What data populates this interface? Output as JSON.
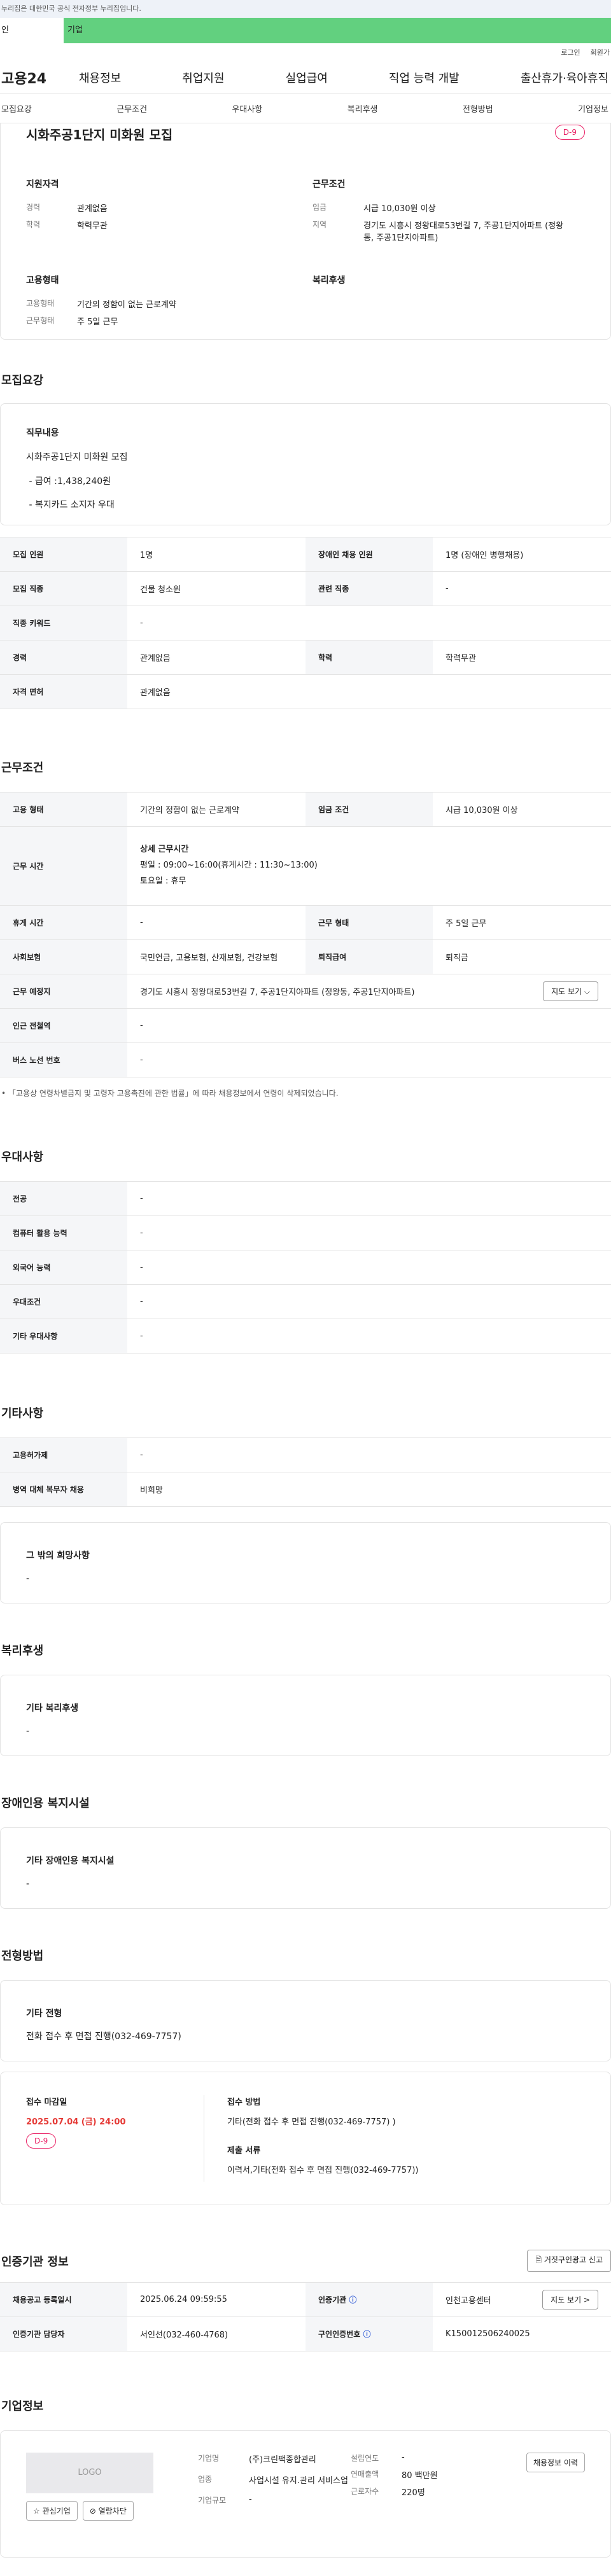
{
  "gov_notice": "누리집은 대한민국 공식 전자정부 누리집입니다.",
  "top_tabs": [
    "인",
    "기업"
  ],
  "util": [
    "로그인",
    "회원가"
  ],
  "gnb": {
    "logo": "고용24",
    "menu": [
      "채용정보",
      "취업지원",
      "실업급여",
      "직업 능력 개발",
      "출산휴가·육아휴직"
    ]
  },
  "subnav": [
    "모집요강",
    "근무조건",
    "우대사항",
    "복리후생",
    "전형방법",
    "기업정보"
  ],
  "summary": {
    "title": "시화주공1단지 미화원 모집",
    "dday": "D-9",
    "qual_title": "지원자격",
    "cond_title": "근무조건",
    "emp_title": "고용형태",
    "welfare_title": "복리후생",
    "career_k": "경력",
    "career_v": "관계없음",
    "edu_k": "학력",
    "edu_v": "학력무관",
    "wage_k": "임금",
    "wage_v": "시급 10,030원 이상",
    "region_k": "지역",
    "region_v": "경기도 시흥시 정왕대로53번길 7, 주공1단지아파트 (정왕동, 주공1단지아파트)",
    "emptype_k": "고용형태",
    "emptype_v": "기간의 정함이 없는 근로계약",
    "worktype_k": "근무형태",
    "worktype_v": "주 5일 근무"
  },
  "recruit": {
    "title": "모집요강",
    "job_head": "직무내용",
    "job_lines": [
      "시화주공1단지 미화원 모집",
      " - 급여 :1,438,240원",
      " - 복지카드 소지자 우대"
    ],
    "rows": [
      [
        "모집 인원",
        "1명",
        "장애인 채용 인원",
        "1명 (장애인 병행채용)"
      ],
      [
        "모집 직종",
        "건물 청소원",
        "관련 직종",
        "-"
      ],
      [
        "직종 키워드",
        "-",
        "",
        ""
      ],
      [
        "경력",
        "관계없음",
        "학력",
        "학력무관"
      ],
      [
        "자격 면허",
        "관계없음",
        "",
        ""
      ]
    ]
  },
  "work": {
    "title": "근무조건",
    "r1": [
      "고용 형태",
      "기간의 정함이 없는 근로계약",
      "임금 조건",
      "시급 10,030원 이상"
    ],
    "hours_k": "근무 시간",
    "hours_head": "상세 근무시간",
    "hours_lines": [
      "평일 : 09:00~16:00(휴게시간 : 11:30~13:00)",
      "토요일 : 휴무"
    ],
    "r3": [
      "휴게 시간",
      "-",
      "근무 형태",
      "주 5일 근무"
    ],
    "r4": [
      "사회보험",
      "국민연금, 고용보험, 산재보험, 건강보험",
      "퇴직급여",
      "퇴직금"
    ],
    "loc_k": "근무 예정지",
    "loc_v": "경기도 시흥시 정왕대로53번길 7, 주공1단지아파트 (정왕동, 주공1단지아파트)",
    "map_btn": "지도 보기 ⌵",
    "r6": [
      "인근 전철역",
      "-"
    ],
    "r7": [
      "버스 노선 번호",
      "-"
    ],
    "note": "「고용상 연령차별금지 및 고령자 고용촉진에 관한 법률」에 따라 채용정보에서 연령이 삭제되었습니다."
  },
  "pref": {
    "title": "우대사항",
    "rows": [
      [
        "전공",
        "-"
      ],
      [
        "컴퓨터 활용 능력",
        "-"
      ],
      [
        "외국어 능력",
        "-"
      ],
      [
        "우대조건",
        "-"
      ],
      [
        "기타 우대사항",
        "-"
      ]
    ]
  },
  "etc": {
    "title": "기타사항",
    "rows": [
      [
        "고용허가제",
        "-"
      ],
      [
        "병역 대체 복무자 채용",
        "비희망"
      ]
    ],
    "card_head": "그 밖의 희망사항",
    "card_val": "-"
  },
  "welfare": {
    "title": "복리후생",
    "head": "기타 복리후생",
    "val": "-"
  },
  "disabled": {
    "title": "장애인용 복지시설",
    "head": "기타 장애인용 복지시설",
    "val": "-"
  },
  "select": {
    "title": "전형방법",
    "head": "기타 전형",
    "val": "전화 접수 후 면접 진행(032-469-7757)",
    "deadline_head": "접수 마감일",
    "deadline": "2025.07.04 (금) 24:00",
    "dday": "D-9",
    "method_head": "접수 방법",
    "method": "기타(전화 접수 후 면접 진행(032-469-7757) )",
    "docs_head": "제출 서류",
    "docs": "이력서,기타(전화 접수 후 면접 진행(032-469-7757))"
  },
  "cert": {
    "title": "인증기관 정보",
    "report_btn": "거짓구인광고 신고",
    "r1": [
      "채용공고 등록일시",
      "2025.06.24 09:59:55",
      "인증기관",
      "인천고용센터"
    ],
    "map_btn": "지도 보기 >",
    "r2": [
      "인증기관 담당자",
      "서인선(032-460-4768)",
      "구인인증번호",
      "K150012506240025"
    ]
  },
  "company": {
    "title": "기업정보",
    "logo": "LOGO",
    "fav": "☆ 관심기업",
    "block": "⊘ 열람차단",
    "name_k": "기업명",
    "name_v": "(주)크린팩종합관리",
    "ind_k": "업종",
    "ind_v": "사업시설 유지.관리 서비스업",
    "size_k": "기업규모",
    "size_v": "-",
    "est_k": "설립연도",
    "est_v": "-",
    "sales_k": "연매출액",
    "sales_v": "80 백만원",
    "emp_k": "근로자수",
    "emp_v": "220명",
    "history_btn": "채용정보 이력"
  }
}
